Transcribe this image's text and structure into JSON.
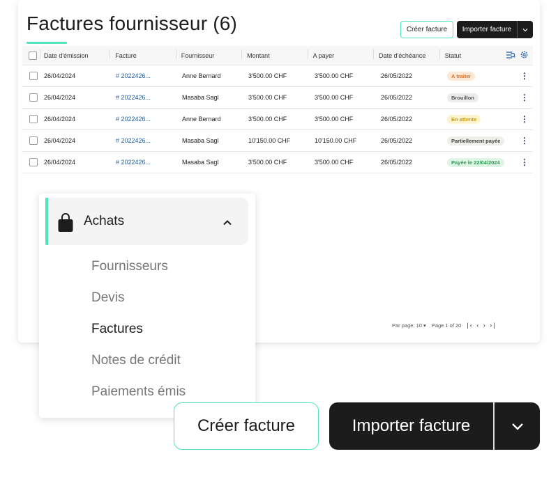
{
  "page": {
    "title": "Factures fournisseur (6)",
    "create_label": "Créer facture",
    "import_label": "Importer facture"
  },
  "table": {
    "headers": [
      "Date d'émission",
      "Facture",
      "Fournisseur",
      "Montant",
      "A payer",
      "Date d'échéance",
      "Statut"
    ],
    "rows": [
      {
        "date": "26/04/2024",
        "facture": "# 2022426...",
        "fournisseur": "Anne Bernard",
        "montant": "3'500.00 CHF",
        "apayer": "3'500.00 CHF",
        "echeance": "26/05/2022",
        "statut": "A traiter"
      },
      {
        "date": "26/04/2024",
        "facture": "# 2022426...",
        "fournisseur": "Masaba Sagl",
        "montant": "3'500.00 CHF",
        "apayer": "3'500.00 CHF",
        "echeance": "26/05/2022",
        "statut": "Brouillon"
      },
      {
        "date": "26/04/2024",
        "facture": "# 2022426...",
        "fournisseur": "Anne Bernard",
        "montant": "3'500.00 CHF",
        "apayer": "3'500.00 CHF",
        "echeance": "26/05/2022",
        "statut": "En attente"
      },
      {
        "date": "26/04/2024",
        "facture": "# 2022426...",
        "fournisseur": "Masaba Sagl",
        "montant": "10'150.00 CHF",
        "apayer": "10'150.00 CHF",
        "echeance": "26/05/2022",
        "statut": "Partiellement payée"
      },
      {
        "date": "26/04/2024",
        "facture": "# 2022426...",
        "fournisseur": "Masaba Sagl",
        "montant": "3'500.00 CHF",
        "apayer": "3'500.00 CHF",
        "echeance": "26/05/2022",
        "statut": "Payée le 22/04/2024"
      }
    ]
  },
  "status_colors": {
    "A traiter": {
      "bg": "#fde8d6",
      "fg": "#d9762b"
    },
    "Brouillon": {
      "bg": "#ececec",
      "fg": "#555555"
    },
    "En attente": {
      "bg": "#fdf3cf",
      "fg": "#c99a10"
    },
    "Partiellement payée": {
      "bg": "#efefe9",
      "fg": "#444444"
    },
    "Payée le 22/04/2024": {
      "bg": "#dff6e6",
      "fg": "#2e9a52"
    }
  },
  "pagination": {
    "per_page": "Par page: 10",
    "page_info": "Page 1 of 20"
  },
  "menu": {
    "section": "Achats",
    "items": [
      "Fournisseurs",
      "Devis",
      "Factures",
      "Notes de crédit",
      "Paiements émis"
    ],
    "active": "Factures"
  },
  "icons": {
    "bag": "shopping-bag-icon",
    "caret": "chevron-up-icon",
    "dropdown": "chevron-down-icon",
    "filter": "filter-icon",
    "settings": "gear-icon",
    "more": "kebab-icon"
  },
  "accent_color": "#4fe3bf"
}
